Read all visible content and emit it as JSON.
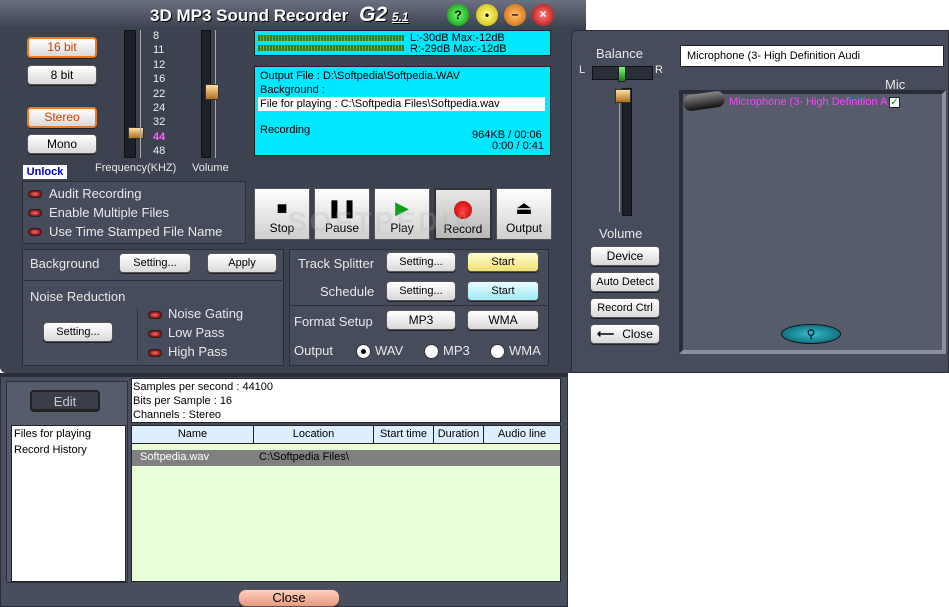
{
  "app": {
    "title": "3D MP3 Sound Recorder",
    "edition": "G2",
    "version": "5.1",
    "title_buttons": [
      "?",
      "•",
      "–",
      "×"
    ]
  },
  "format": {
    "bit16": "16 bit",
    "bit8": "8 bit",
    "stereo": "Stereo",
    "mono": "Mono",
    "unlock": "Unlock"
  },
  "frequency": {
    "ticks": [
      "8",
      "11",
      "12",
      "16",
      "22",
      "24",
      "32",
      "44",
      "48"
    ],
    "selected": "44",
    "label": "Frequency(KHZ)",
    "volume_label": "Volume"
  },
  "meters": {
    "left": "L:-30dB Max:-12dB",
    "right": "R:-29dB Max:-12dB"
  },
  "info": {
    "output": "Output   File : D:\\Softpedia\\Softpedia.WAV",
    "background": "Background :",
    "file_playing": "File for playing : C:\\Softpedia Files\\Softpedia.wav",
    "status": "Recording",
    "size_time": "964KB / 00:06",
    "play_time": "0:00 / 0:41"
  },
  "options": [
    "Audit Recording",
    "Enable Multiple Files",
    "Use Time Stamped File Name"
  ],
  "transport": {
    "stop": "Stop",
    "pause": "Pause",
    "play": "Play",
    "record": "Record",
    "output": "Output"
  },
  "background": {
    "label": "Background",
    "setting": "Setting...",
    "apply": "Apply"
  },
  "noise": {
    "label": "Noise Reduction",
    "setting": "Setting...",
    "gating": "Noise Gating",
    "low": "Low Pass",
    "high": "High Pass"
  },
  "splitter": {
    "label": "Track Splitter",
    "setting": "Setting...",
    "start": "Start"
  },
  "schedule": {
    "label": "Schedule",
    "setting": "Setting...",
    "start": "Start"
  },
  "format_setup": {
    "label": "Format Setup",
    "mp3": "MP3",
    "wma": "WMA"
  },
  "output_format": {
    "label": "Output",
    "options": [
      "WAV",
      "MP3",
      "WMA"
    ],
    "selected": "WAV"
  },
  "mixer": {
    "balance": "Balance",
    "left": "L",
    "right": "R",
    "volume": "Volume",
    "device_select": "Microphone (3- High Definition Audi",
    "mic_label": "Mic",
    "mic_item": "Microphone (3- High Definition Au",
    "device": "Device",
    "auto_detect": "Auto Detect",
    "record_ctrl": "Record Ctrl",
    "close": "Close"
  },
  "bottom": {
    "edit": "Edit",
    "nav": [
      "Files for playing",
      "Record History"
    ],
    "samples": "Samples per second : 44100",
    "bits": "Bits per Sample : 16",
    "channels": "Channels : Stereo",
    "columns": [
      "Name",
      "Location",
      "Start time",
      "Duration",
      "Audio line"
    ],
    "rows": [
      {
        "name": "Softpedia.wav",
        "location": "C:\\Softpedia Files\\"
      }
    ],
    "close": "Close"
  },
  "watermark": "SOFTPEDIA"
}
